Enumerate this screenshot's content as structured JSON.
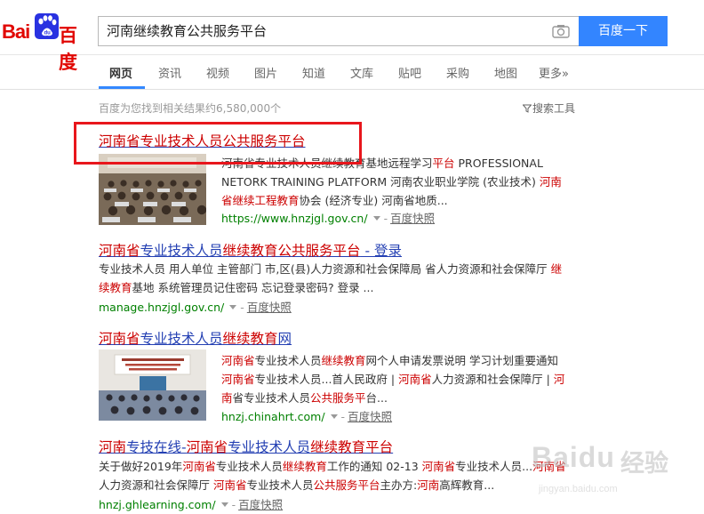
{
  "header": {
    "logo_text_left": "Bai",
    "logo_text_right": "百度",
    "search_value": "河南继续教育公共服务平台",
    "search_button": "百度一下"
  },
  "tabs": [
    {
      "label": "网页",
      "active": true
    },
    {
      "label": "资讯"
    },
    {
      "label": "视频"
    },
    {
      "label": "图片"
    },
    {
      "label": "知道"
    },
    {
      "label": "文库"
    },
    {
      "label": "贴吧"
    },
    {
      "label": "采购"
    },
    {
      "label": "地图"
    },
    {
      "label": "更多»"
    }
  ],
  "stats_text": "百度为您找到相关结果约6,580,000个",
  "tools_label": "搜索工具",
  "results": [
    {
      "title": "河南省专业技术人员公共服务平台",
      "snippet_lines": [
        [
          "河南省专业技术人员继续教育基地远程学习",
          {
            "em": "平台"
          },
          " PROFESSIONAL"
        ],
        [
          "NETORK TRAINING PLATFORM 河南农业职业学院 (农业技术) ",
          {
            "em": "河南"
          }
        ],
        [
          {
            "em": "省继续工程教育"
          },
          "协会 (经济专业) 河南省地质..."
        ]
      ],
      "url": "https://www.hnzjgl.gov.cn/",
      "cache": "百度快照"
    },
    {
      "title_parts": [
        {
          "em": "河南省"
        },
        "专业技术人员",
        {
          "em": "继续教育公共服务平台"
        },
        " - 登录"
      ],
      "snippet_lines": [
        [
          "专业技术人员 用人单位 主管部门 市,区(县)人力资源和社会保障局 省人力资源和社会保障厅 ",
          {
            "em": "继"
          }
        ],
        [
          {
            "em": "续教育"
          },
          "基地 系统管理员记住密码 忘记登录密码? 登录 ..."
        ]
      ],
      "url": "manage.hnzjgl.gov.cn/",
      "cache": "百度快照"
    },
    {
      "title_parts": [
        {
          "em": "河南省"
        },
        "专业技术人员",
        {
          "em": "继续教育"
        },
        "网"
      ],
      "snippet_lines": [
        [
          {
            "em": "河南省"
          },
          "专业技术人员",
          {
            "em": "继续教育"
          },
          "网个人申请发票说明 学习计划重要通知"
        ],
        [
          {
            "em": "河南省"
          },
          "专业技术人员...首人民政府 | ",
          {
            "em": "河南省"
          },
          "人力资源和社会保障厅 | ",
          {
            "em": "河"
          }
        ],
        [
          {
            "em": "南"
          },
          "省专业技术人员",
          {
            "em": "公共服务平"
          },
          "台..."
        ]
      ],
      "url": "hnzj.chinahrt.com/",
      "cache": "百度快照"
    },
    {
      "title_parts": [
        {
          "em": "河南"
        },
        "专技在线-",
        {
          "em": "河南省"
        },
        "专业技术人员",
        {
          "em": "继续教育平台"
        }
      ],
      "snippet_lines": [
        [
          "关于做好2019年",
          {
            "em": "河南省"
          },
          "专业技术人员",
          {
            "em": "继续教育"
          },
          "工作的通知 02-13 ",
          {
            "em": "河南省"
          },
          "专业技术人员...",
          {
            "em": "河南省"
          }
        ],
        [
          "人力资源和社会保障厅 ",
          {
            "em": "河南省"
          },
          "专业技术人员",
          {
            "em": "公共服务平台"
          },
          "主办方:",
          {
            "em": "河南"
          },
          "高辉教育..."
        ]
      ],
      "url": "hnzj.ghlearning.com/",
      "cache": "百度快照"
    }
  ],
  "watermark": {
    "brand": "Baidu",
    "cn": "经验",
    "url": "jingyan.baidu.com"
  },
  "colors": {
    "accent": "#3385ff",
    "title_blue": "#2440b3",
    "highlight": "#c00",
    "url_green": "#008000",
    "annotation_red": "#e8161c"
  }
}
